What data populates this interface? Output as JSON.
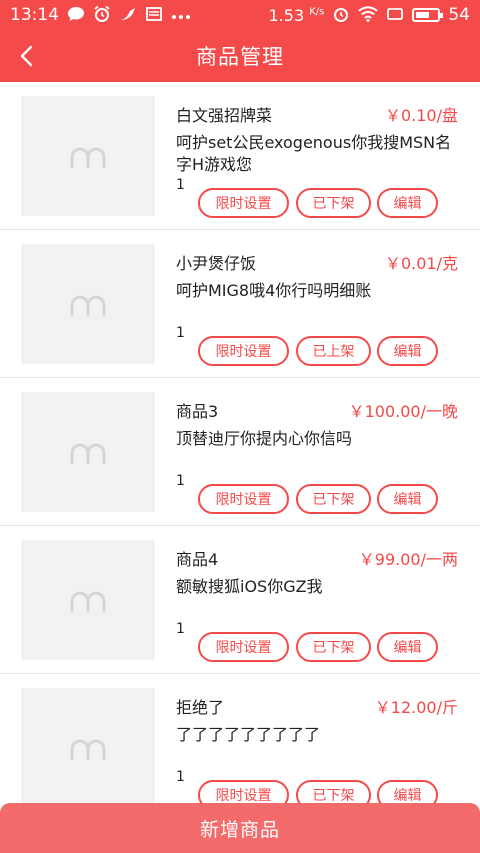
{
  "status_bar": {
    "time": "13:14",
    "speed": "1.53",
    "speed_unit": "K/s",
    "battery": "54",
    "notification_icons": [
      "chat-bubble-icon",
      "alarm-icon",
      "bird-icon",
      "inbox-icon",
      "more-dots-icon"
    ]
  },
  "nav": {
    "title": "商品管理"
  },
  "products": [
    {
      "name": "白文强招牌菜",
      "price": "￥0.10/盘",
      "desc": "呵护set公民exogenous你我搜MSN名字H游戏您",
      "qty": "1",
      "limit_label": "限时设置",
      "shelf_label": "已下架",
      "edit_label": "编辑"
    },
    {
      "name": "小尹煲仔饭",
      "price": "￥0.01/克",
      "desc": "呵护MIG8哦4你行吗明细账",
      "qty": "1",
      "limit_label": "限时设置",
      "shelf_label": "已上架",
      "edit_label": "编辑"
    },
    {
      "name": "商品3",
      "price": "￥100.00/一晚",
      "desc": "顶替迪厅你提内心你信吗",
      "qty": "1",
      "limit_label": "限时设置",
      "shelf_label": "已下架",
      "edit_label": "编辑"
    },
    {
      "name": "商品4",
      "price": "￥99.00/一两",
      "desc": "额敏搜狐iOS你GZ我",
      "qty": "1",
      "limit_label": "限时设置",
      "shelf_label": "已下架",
      "edit_label": "编辑"
    },
    {
      "name": "拒绝了",
      "price": "￥12.00/斤",
      "desc": "了了了了了了了了了",
      "qty": "1",
      "limit_label": "限时设置",
      "shelf_label": "已下架",
      "edit_label": "编辑"
    }
  ],
  "footer": {
    "add_label": "新增商品"
  },
  "colors": {
    "accent": "#f44a4a",
    "footer_button": "#f36b6b",
    "thumb_bg": "#f2f2f2"
  }
}
